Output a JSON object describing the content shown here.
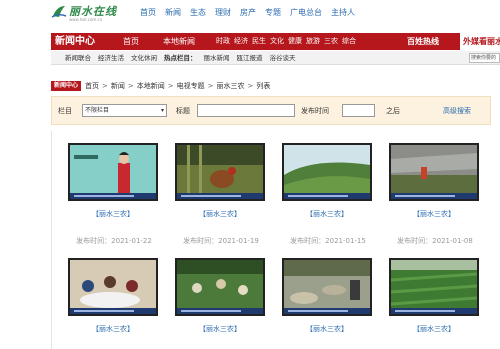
{
  "site": {
    "logo_name": "丽水在线",
    "logo_url": "www.lsol.com.cn"
  },
  "top_nav": [
    "首页",
    "新闻",
    "生态",
    "理财",
    "房产",
    "专题",
    "广电总台",
    "主持人"
  ],
  "header": {
    "brand": "新闻中心",
    "home": "首页",
    "local_news": "本地新闻",
    "categories": [
      "时政",
      "经济",
      "民生",
      "文化",
      "健康",
      "旅游",
      "三农",
      "综合"
    ],
    "hotline": "百姓热线",
    "external": "外媒看丽水"
  },
  "sub_bar": {
    "items": [
      "新闻联合",
      "经济生活",
      "文化休闲",
      "热点栏目：",
      "丽水新闻",
      "瓯江报道",
      "浴谷谈天"
    ],
    "search_value": "搜索你要的"
  },
  "breadcrumb": {
    "tag": "新闻中心",
    "items": [
      "首页",
      "新闻",
      "本地新闻",
      "电视专题",
      "丽水三农",
      "列表"
    ]
  },
  "filter": {
    "column_label": "栏目",
    "column_value": "不限栏目",
    "title_label": "标题",
    "time_label": "发布时间",
    "after_label": "之后",
    "advanced_search": "高级搜索"
  },
  "colors": {
    "brand_red": "#b5171c",
    "link_blue": "#2b6cb0",
    "filter_bg": "#fdf2df"
  },
  "videos": [
    {
      "caption": "【丽水三农】",
      "date": "发布时间：2021-01-22"
    },
    {
      "caption": "【丽水三农】",
      "date": "发布时间：2021-01-19"
    },
    {
      "caption": "【丽水三农】",
      "date": "发布时间：2021-01-15"
    },
    {
      "caption": "【丽水三农】",
      "date": "发布时间：2021-01-08"
    },
    {
      "caption": "【丽水三农】",
      "date": ""
    },
    {
      "caption": "【丽水三农】",
      "date": ""
    },
    {
      "caption": "【丽水三农】",
      "date": ""
    },
    {
      "caption": "【丽水三农】",
      "date": ""
    }
  ]
}
